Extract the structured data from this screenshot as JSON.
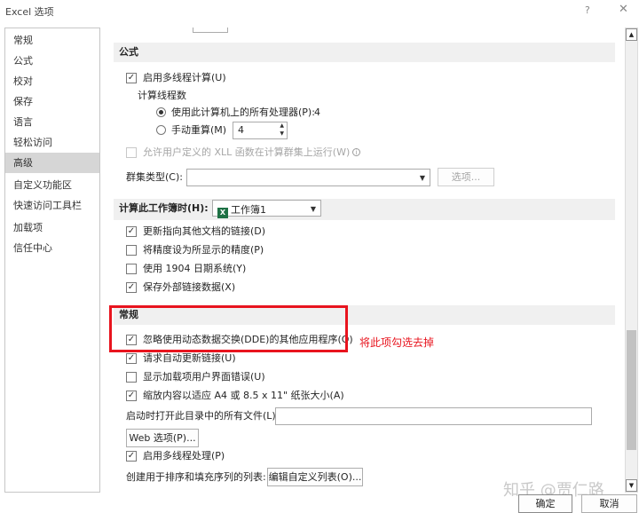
{
  "window": {
    "title": "Excel 选项",
    "help": "?",
    "close": "✕"
  },
  "nav": {
    "items": [
      {
        "label": "常规"
      },
      {
        "label": "公式"
      },
      {
        "label": "校对"
      },
      {
        "label": "保存"
      },
      {
        "label": "语言"
      },
      {
        "label": "轻松访问"
      },
      {
        "label": "高级",
        "selected": true
      },
      {
        "label": "自定义功能区"
      },
      {
        "label": "快速访问工具栏"
      },
      {
        "label": "加载项"
      },
      {
        "label": "信任中心"
      }
    ]
  },
  "formulas": {
    "heading": "公式",
    "multithread": {
      "label": "启用多线程计算(U)",
      "checked": true
    },
    "threads_label": "计算线程数",
    "use_all": {
      "label": "使用此计算机上的所有处理器(P):",
      "value": "4",
      "selected": true
    },
    "manual": {
      "label": "手动重算(M)",
      "value": "4",
      "selected": false
    },
    "xll": {
      "label": "允许用户定义的 XLL 函数在计算群集上运行(W)",
      "checked": false,
      "disabled": true
    },
    "cluster_label": "群集类型(C):",
    "options_button": "选项..."
  },
  "workbook": {
    "heading": "计算此工作簿时(H):",
    "selected": "工作簿1",
    "options": [
      {
        "label": "更新指向其他文档的链接(D)",
        "checked": true
      },
      {
        "label": "将精度设为所显示的精度(P)",
        "checked": false
      },
      {
        "label": "使用 1904 日期系统(Y)",
        "checked": false
      },
      {
        "label": "保存外部链接数据(X)",
        "checked": true
      }
    ]
  },
  "general": {
    "heading": "常规",
    "options": [
      {
        "label": "忽略使用动态数据交换(DDE)的其他应用程序(O)",
        "checked": true
      },
      {
        "label": "请求自动更新链接(U)",
        "checked": true
      },
      {
        "label": "显示加载项用户界面错误(U)",
        "checked": false
      },
      {
        "label": "缩放内容以适应 A4 或 8.5 x 11\" 纸张大小(A)",
        "checked": true
      }
    ],
    "startup_label": "启动时打开此目录中的所有文件(L):",
    "startup_value": "",
    "web_button": "Web 选项(P)...",
    "multiprocess": {
      "label": "启用多线程处理(P)",
      "checked": true
    },
    "custom_list_label": "创建用于排序和填充序列的列表:",
    "custom_list_button": "编辑自定义列表(O)..."
  },
  "annotation": "将此项勾选去掉",
  "watermark": "知乎 @贾仁路",
  "footer": {
    "ok": "确定",
    "cancel": "取消"
  },
  "colors": {
    "annotation": "#e8141e",
    "section_bg": "#f0f0f0",
    "nav_selected": "#d6d6d6"
  }
}
